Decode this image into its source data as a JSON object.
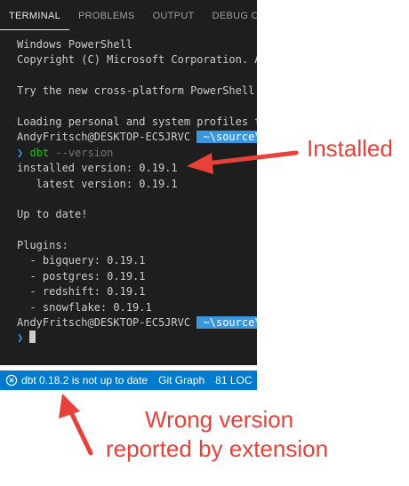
{
  "tabs": [
    "TERMINAL",
    "PROBLEMS",
    "OUTPUT",
    "DEBUG CO"
  ],
  "terminal": {
    "line1": "Windows PowerShell",
    "line2": "Copyright (C) Microsoft Corporation. All",
    "line4": "Try the new cross-platform PowerShell h",
    "line6": "Loading personal and system profiles to",
    "prompt_user": "AndyFritsch@DESKTOP-EC5JRVC",
    "prompt_path": " ~\\source\\",
    "prompt_glyph": "❯",
    "cmd_name": "dbt",
    "cmd_args": " --version",
    "installed": "installed version: 0.19.1",
    "latest": "   latest version: 0.19.1",
    "uptodate": "Up to date!",
    "plugins": "Plugins:",
    "plugin_list": [
      "  - bigquery: 0.19.1",
      "  - postgres: 0.19.1",
      "  - redshift: 0.19.1",
      "  - snowflake: 0.19.1"
    ]
  },
  "statusbar": {
    "dbt_status": "dbt 0.18.2 is not up to date",
    "git_graph": "Git Graph",
    "loc": "81 LOC"
  },
  "annotations": {
    "installed": "Installed",
    "wrong_line1": "Wrong version",
    "wrong_line2": "reported by extension"
  },
  "colors": {
    "terminal_bg": "#1e1e1e",
    "statusbar_bg": "#007acc",
    "annotation": "#e8413a"
  }
}
